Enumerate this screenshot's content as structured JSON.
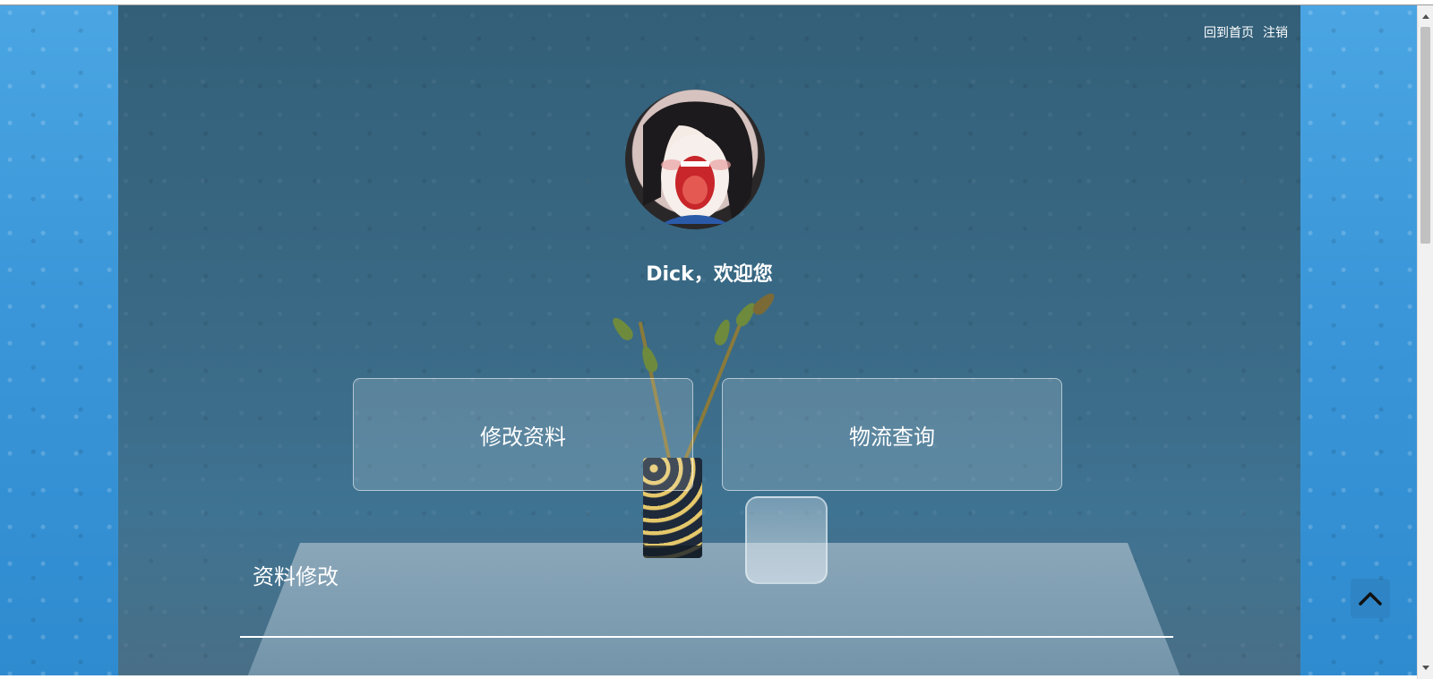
{
  "header": {
    "links": {
      "home": "回到首页",
      "logout": "注销"
    }
  },
  "profile": {
    "welcome": "Dick，欢迎您"
  },
  "tiles": {
    "edit_profile": "修改资料",
    "logistics": "物流查询"
  },
  "section": {
    "title": "资料修改"
  },
  "icons": {
    "back_to_top": "chevron-up-icon"
  }
}
